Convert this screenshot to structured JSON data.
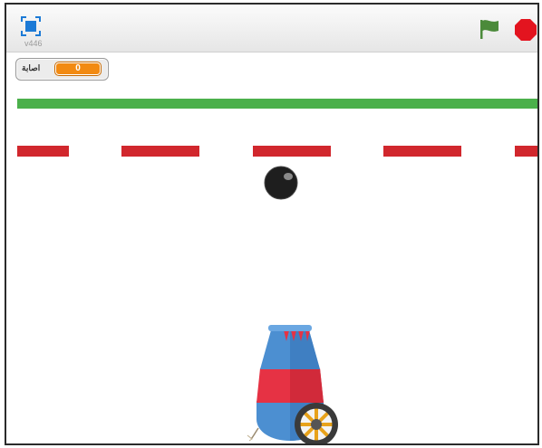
{
  "topbar": {
    "version": "v446",
    "fullscreen_icon": "fullscreen-icon",
    "flag_icon": "green-flag-icon",
    "stop_icon": "stop-icon"
  },
  "stage": {
    "monitor": {
      "label": "اصابة",
      "value": "0"
    },
    "sprites": [
      "ball",
      "cannon"
    ]
  },
  "colors": {
    "accent": "#1c7ad6",
    "flag": "#4b8a3a",
    "stop": "#e3141f",
    "monitor_value": "#f28a12",
    "green_line": "#4bb04b",
    "red_dash": "#d1272d"
  }
}
